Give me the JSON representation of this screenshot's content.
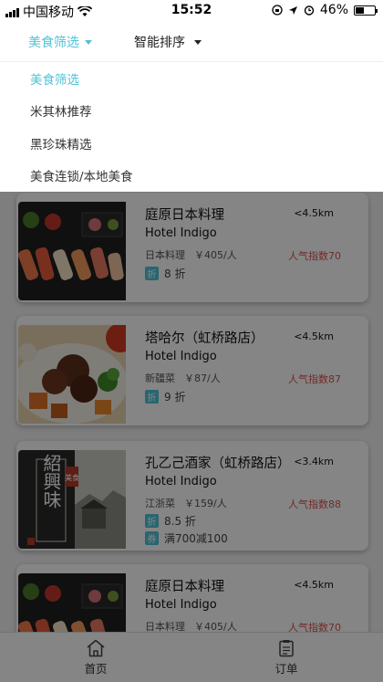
{
  "status_bar": {
    "carrier": "中国移动",
    "time": "15:52",
    "battery": "46%",
    "battery_level": 0.46
  },
  "filter_bar": {
    "tabs": [
      {
        "label": "美食筛选",
        "active": true
      },
      {
        "label": "智能排序",
        "active": false
      }
    ]
  },
  "dropdown": {
    "items": [
      {
        "label": "美食筛选",
        "active": true
      },
      {
        "label": "米其林推荐",
        "active": false
      },
      {
        "label": "黑珍珠精选",
        "active": false
      },
      {
        "label": "美食连锁/本地美食",
        "active": false
      }
    ]
  },
  "restaurants": [
    {
      "name": "庭原日本料理",
      "english": "Hotel Indigo",
      "distance": "<4.5km",
      "category": "日本料理",
      "price": "￥405/人",
      "popularity": "人气指数70",
      "discount_badge": "折",
      "discount": "8 折"
    },
    {
      "name": "塔哈尔（虹桥路店）",
      "english": "Hotel Indigo",
      "distance": "<4.5km",
      "category": "新疆菜",
      "price": "￥87/人",
      "popularity": "人气指数87",
      "discount_badge": "折",
      "discount": "9 折"
    },
    {
      "name": "孔乙己酒家（虹桥路店）",
      "english": "Hotel Indigo",
      "distance": "<3.4km",
      "category": "江浙菜",
      "price": "￥159/人",
      "popularity": "人气指数88",
      "discount_badge": "折",
      "discount": "8.5 折",
      "coupon_badge": "券",
      "coupon": "满700减100",
      "image_text": "紹興味",
      "image_tag": "美食"
    },
    {
      "name": "庭原日本料理",
      "english": "Hotel Indigo",
      "distance": "<4.5km",
      "category": "日本料理",
      "price": "￥405/人",
      "popularity": "人气指数70"
    }
  ],
  "tab_bar": {
    "tabs": [
      {
        "label": "首页",
        "icon": "home-icon"
      },
      {
        "label": "订单",
        "icon": "order-icon"
      }
    ]
  },
  "colors": {
    "accent": "#4ec3d9",
    "popularity": "#d9534f",
    "overlay": "rgba(0,0,0,0.48)"
  }
}
